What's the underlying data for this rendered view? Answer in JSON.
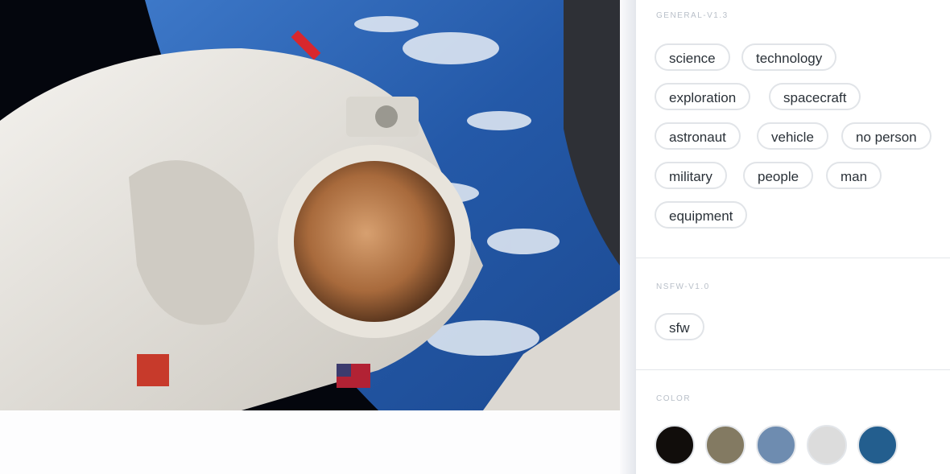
{
  "photo": {
    "subject": "astronaut spacewalk above Earth"
  },
  "sections": {
    "general": {
      "title": "GENERAL-V1.3",
      "tags": [
        "science",
        "technology",
        "exploration",
        "spacecraft",
        "astronaut",
        "vehicle",
        "no person",
        "military",
        "people",
        "man",
        "equipment"
      ]
    },
    "nsfw": {
      "title": "NSFW-V1.0",
      "tags": [
        "sfw"
      ]
    },
    "color": {
      "title": "COLOR",
      "swatches": [
        "#110d0b",
        "#837a62",
        "#6e8cb0",
        "#dcdcdc",
        "#235e8e"
      ]
    }
  }
}
